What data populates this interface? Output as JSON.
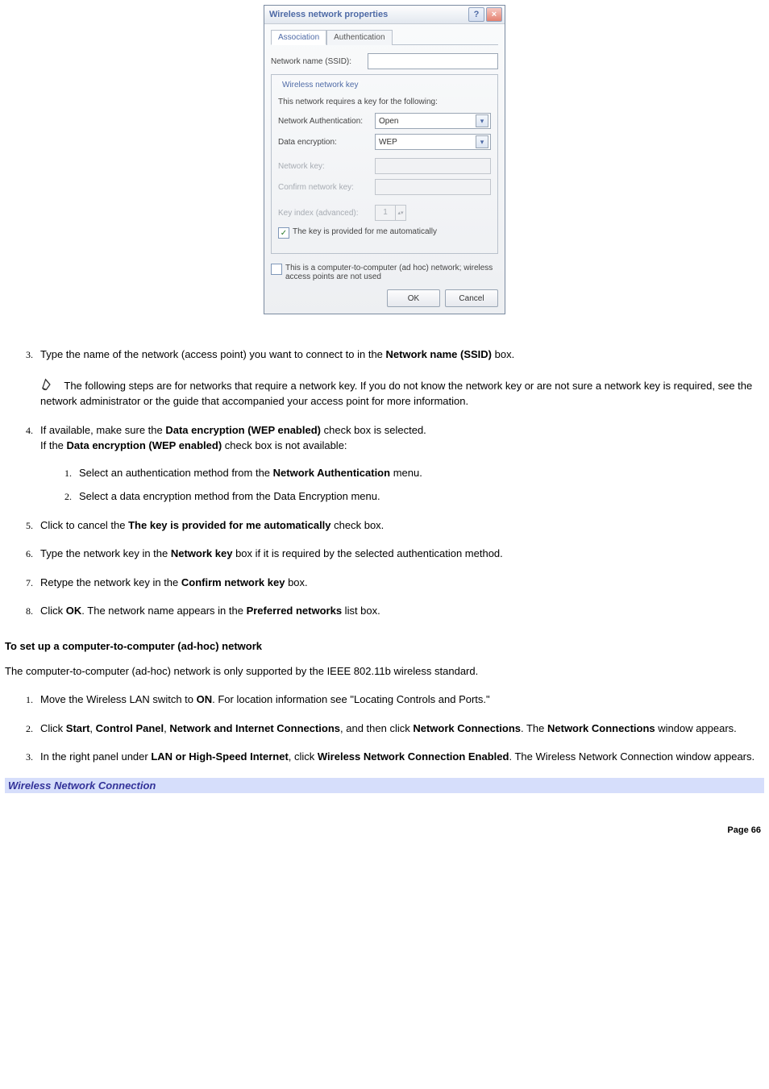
{
  "dialog": {
    "title": "Wireless network properties",
    "tabs": {
      "active": "Association",
      "inactive": "Authentication"
    },
    "ssid_label": "Network name (SSID):",
    "fieldset_legend": "Wireless network key",
    "requires_text": "This network requires a key for the following:",
    "auth_label": "Network Authentication:",
    "auth_value": "Open",
    "enc_label": "Data encryption:",
    "enc_value": "WEP",
    "netkey_label": "Network key:",
    "confirm_label": "Confirm network key:",
    "keyindex_label": "Key index (advanced):",
    "keyindex_value": "1",
    "auto_key_text": "The key is provided for me automatically",
    "adhoc_text": "This is a computer-to-computer (ad hoc) network; wireless access points are not used",
    "ok": "OK",
    "cancel": "Cancel"
  },
  "instr": {
    "step3_a": "Type the name of the network (access point) you want to connect to in the ",
    "step3_b": "Network name (SSID)",
    "step3_c": " box.",
    "note": " The following steps are for networks that require a network key. If you do not know the network key or are not sure a network key is required, see the network administrator or the guide that accompanied your access point for more information.",
    "step4_line1_a": "If available, make sure the ",
    "step4_line1_b": "Data encryption (WEP enabled)",
    "step4_line1_c": " check box is selected.",
    "step4_line2_a": "If the ",
    "step4_line2_b": "Data encryption (WEP enabled)",
    "step4_line2_c": " check box is not available:",
    "step4_1_a": "Select an authentication method from the ",
    "step4_1_b": "Network Authentication",
    "step4_1_c": " menu.",
    "step4_2": "Select a data encryption method from the Data Encryption menu.",
    "step5_a": "Click to cancel the ",
    "step5_b": "The key is provided for me automatically",
    "step5_c": " check box.",
    "step6_a": "Type the network key in the ",
    "step6_b": "Network key",
    "step6_c": " box if it is required by the selected authentication method.",
    "step7_a": "Retype the network key in the ",
    "step7_b": "Confirm network key",
    "step7_c": " box.",
    "step8_a": "Click ",
    "step8_b": "OK",
    "step8_c": ". The network name appears in the ",
    "step8_d": "Preferred networks",
    "step8_e": " list box."
  },
  "adhoc_section": {
    "heading": "To set up a computer-to-computer (ad-hoc) network",
    "intro": "The computer-to-computer (ad-hoc) network is only supported by the IEEE 802.11b wireless standard.",
    "step1_a": "Move the Wireless LAN switch to ",
    "step1_b": "ON",
    "step1_c": ". For location information see \"Locating Controls and Ports.\"",
    "step2_a": "Click ",
    "step2_b": "Start",
    "step2_c": ", ",
    "step2_d": "Control Panel",
    "step2_e": ", ",
    "step2_f": "Network and Internet Connections",
    "step2_g": ", and then click ",
    "step2_h": "Network Connections",
    "step2_i": ". The ",
    "step2_j": "Network Connections",
    "step2_k": " window appears.",
    "step3_a": "In the right panel under ",
    "step3_b": "LAN or High-Speed Internet",
    "step3_c": ", click ",
    "step3_d": "Wireless Network Connection Enabled",
    "step3_e": ". The Wireless Network Connection window appears."
  },
  "caption": "Wireless Network Connection",
  "page_number": "Page 66"
}
